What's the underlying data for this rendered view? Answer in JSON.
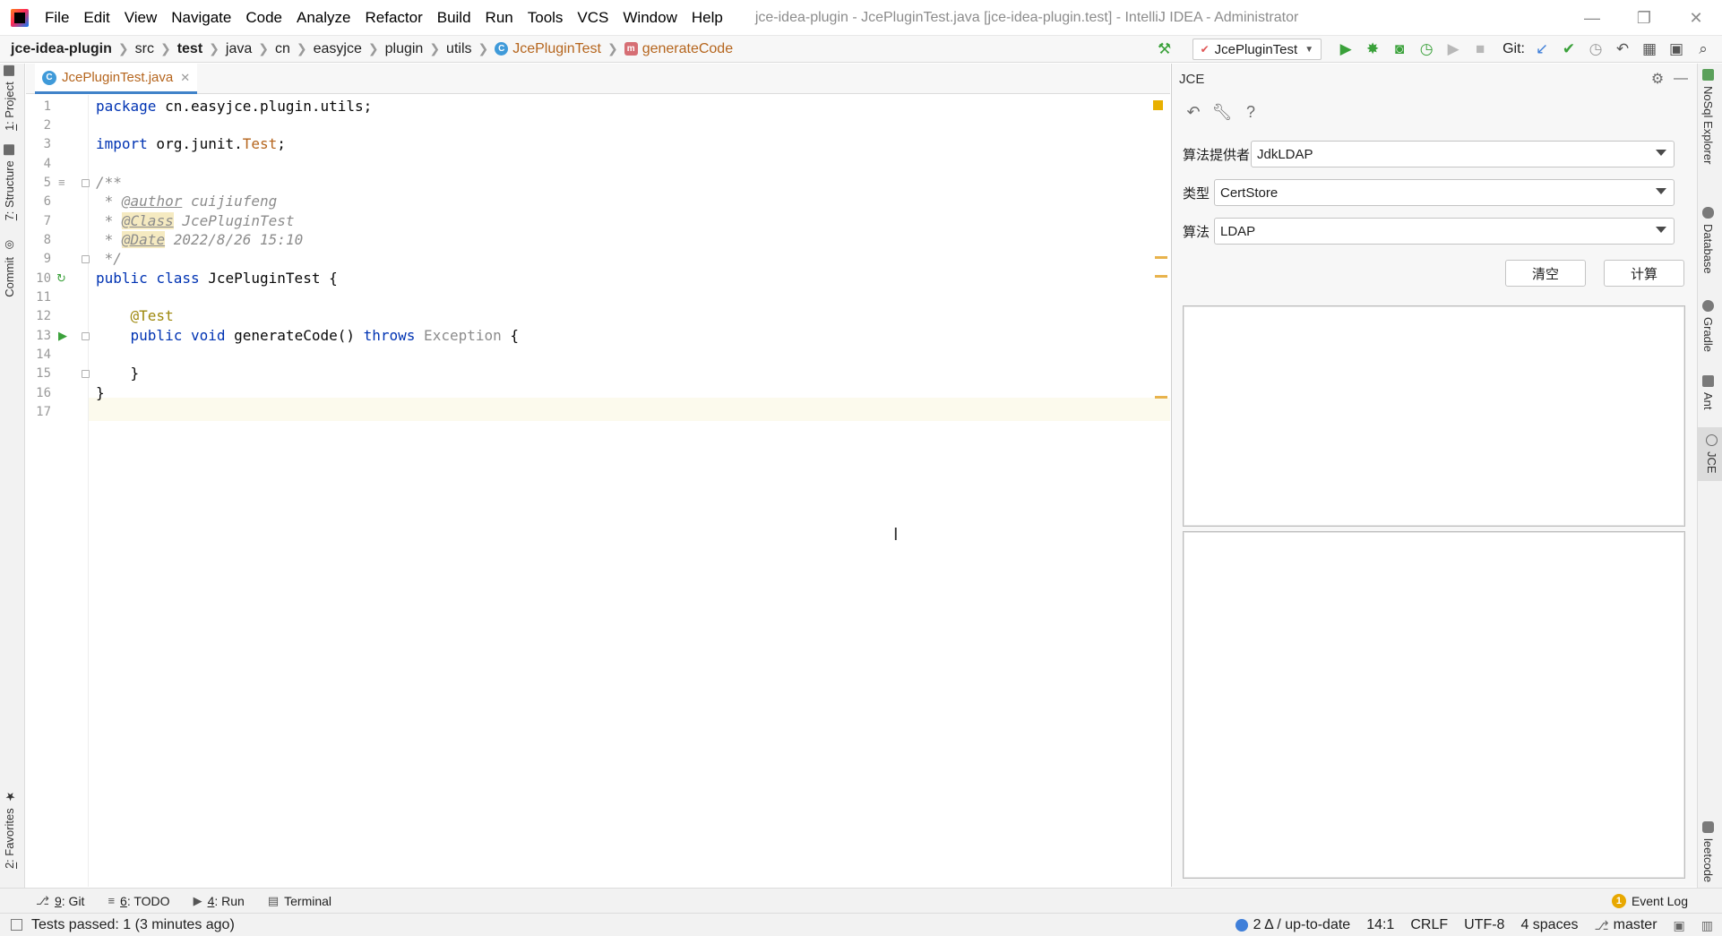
{
  "app": {
    "window_title": "jce-idea-plugin - JcePluginTest.java [jce-idea-plugin.test] - IntelliJ IDEA - Administrator"
  },
  "menu": [
    "File",
    "Edit",
    "View",
    "Navigate",
    "Code",
    "Analyze",
    "Refactor",
    "Build",
    "Run",
    "Tools",
    "VCS",
    "Window",
    "Help"
  ],
  "breadcrumb": {
    "project": "jce-idea-plugin",
    "parts": [
      "src",
      "test",
      "java",
      "cn",
      "easyjce",
      "plugin",
      "utils"
    ],
    "class": "JcePluginTest",
    "method": "generateCode"
  },
  "toolbar": {
    "run_config": "JcePluginTest",
    "git_label": "Git:"
  },
  "left_tabs": {
    "project": {
      "num": "1",
      "label": ": Project"
    },
    "structure": {
      "num": "7",
      "label": ": Structure"
    },
    "commit": "Commit",
    "favorites": {
      "num": "2",
      "label": ": Favorites"
    }
  },
  "right_tabs": [
    "NoSql Explorer",
    "Database",
    "Gradle",
    "Ant",
    "JCE",
    "leetcode"
  ],
  "editor": {
    "tab_name": "JcePluginTest.java",
    "line_numbers": [
      "1",
      "2",
      "3",
      "4",
      "5",
      "6",
      "7",
      "8",
      "9",
      "10",
      "11",
      "12",
      "13",
      "14",
      "15",
      "16",
      "17"
    ],
    "code": {
      "l1_kw": "package",
      "l1_rest": " cn.easyjce.plugin.utils;",
      "l3_kw": "import",
      "l3_mid": " org.junit.",
      "l3_cls": "Test",
      "l3_end": ";",
      "l5": "/**",
      "l6_star": " * ",
      "l6_tag": "@author",
      "l6_val": " cuijiufeng",
      "l7_star": " * ",
      "l7_tag": "@Class",
      "l7_val": " JcePluginTest",
      "l8_star": " * ",
      "l8_tag": "@Date",
      "l8_val": " 2022/8/26 15:10",
      "l9": " */",
      "l10_kw": "public class",
      "l10_rest": " JcePluginTest {",
      "l12": "    @Test",
      "l13_indent": "    ",
      "l13_kw": "public void",
      "l13_mid": " generateCode() ",
      "l13_throws": "throws",
      "l13_exc": " Exception",
      "l13_end": " {",
      "l15": "    }",
      "l16": "}"
    }
  },
  "jce": {
    "title": "JCE",
    "provider_label": "算法提供者",
    "provider_value": "JdkLDAP",
    "type_label": "类型",
    "type_value": "CertStore",
    "algo_label": "算法",
    "algo_value": "LDAP",
    "clear_button": "清空",
    "compute_button": "计算"
  },
  "bottom_tabs": {
    "git": {
      "num": "9",
      "label": ": Git"
    },
    "todo": {
      "num": "6",
      "label": ": TODO"
    },
    "run": {
      "num": "4",
      "label": ": Run"
    },
    "terminal": "Terminal",
    "event_log": "Event Log",
    "event_badge": "1"
  },
  "status": {
    "message": "Tests passed: 1 (3 minutes ago)",
    "vcs": "2 Δ / up-to-date",
    "position": "14:1",
    "line_sep": "CRLF",
    "encoding": "UTF-8",
    "indent": "4 spaces",
    "branch": "master"
  },
  "colors": {
    "keyword": "#0033b3",
    "annotation": "#9e880d",
    "comment": "#8c8c8c",
    "class_ref": "#b5651d",
    "run_green": "#3aa13a",
    "accent_blue": "#4083c9"
  }
}
